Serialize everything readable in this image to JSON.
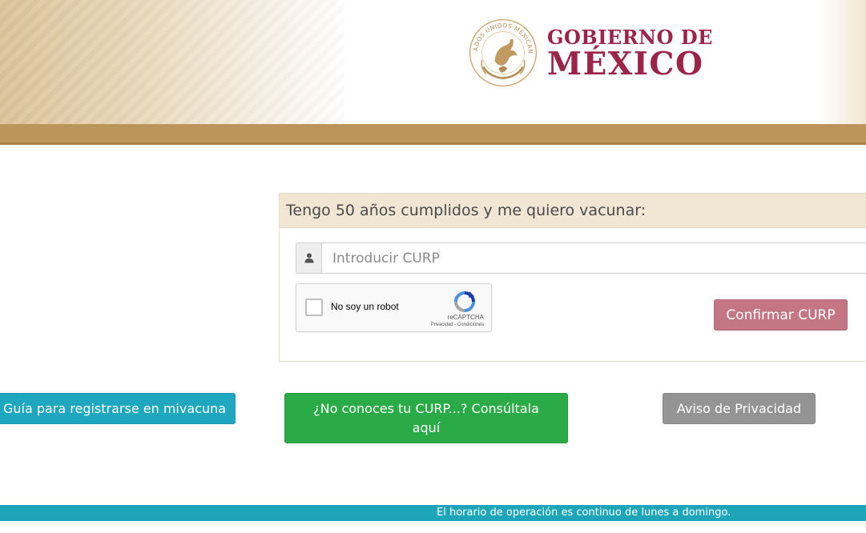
{
  "header": {
    "seal_text": "ESTADOS UNIDOS MEXICANOS",
    "gov_line1": "GOBIERNO DE",
    "gov_line2": "MÉXICO"
  },
  "form": {
    "heading": "Tengo 50 años cumplidos y me quiero vacunar:",
    "curp_input": {
      "value": "",
      "placeholder": "Introducir CURP"
    },
    "user_icon": "user-icon",
    "recaptcha": {
      "label": "No soy un robot",
      "brand": "reCAPTCHA",
      "links": "Privacidad - Condiciones"
    },
    "confirm_label": "Confirmar CURP"
  },
  "actions": {
    "guide_label": "Guía para registrarse en mivacuna",
    "curp_help_label": "¿No conoces tu CURP...? Consúltala aquí",
    "privacy_label": "Aviso de Privacidad"
  },
  "footer": {
    "text": "El horario de operación es continuo de lunes a domingo."
  },
  "colors": {
    "brand_guinda": "#9d2449",
    "gold": "#bc955c",
    "teal": "#1ea7bf",
    "green": "#2bab47",
    "gray": "#949494",
    "confirm_pink": "#c47685"
  }
}
